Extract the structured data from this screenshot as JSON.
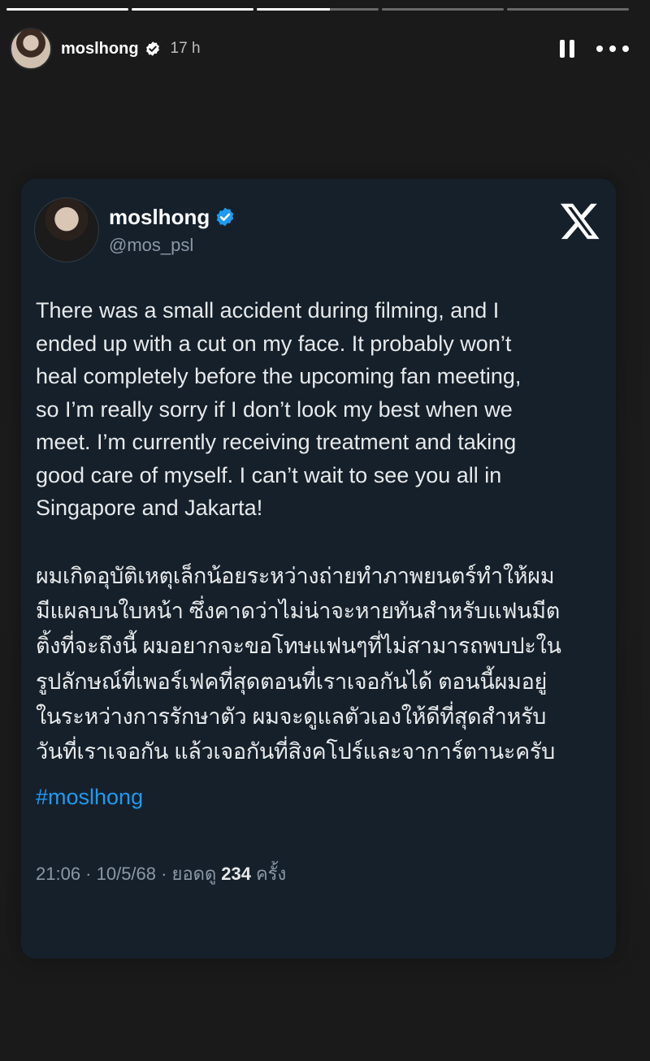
{
  "story": {
    "progress": [
      1,
      1,
      0.6,
      0,
      0
    ],
    "username": "moslhong",
    "time": "17 h"
  },
  "tweet": {
    "display_name": "moslhong",
    "handle": "@mos_psl",
    "text_en": "There was a small accident during filming, and I\nended up with a cut on my face. It probably won’t\nheal completely before the upcoming fan meeting,\nso I’m really sorry if I don’t look my best when we\nmeet. I’m currently receiving treatment and taking\ngood care of myself. I can’t wait to see you all in\nSingapore and Jakarta!",
    "text_th": "ผมเกิดอุบัติเหตุเล็กน้อยระหว่างถ่ายทำภาพยนตร์ทำให้ผม\nมีแผลบนใบหน้า ซึ่งคาดว่าไม่น่าจะหายทันสำหรับแฟนมีต\nติ้งที่จะถึงนี้ ผมอยากจะขอโทษแฟนๆที่ไม่สามารถพบปะใน\nรูปลักษณ์ที่เพอร์เฟคที่สุดตอนที่เราเจอกันได้ ตอนนี้ผมอยู่\nในระหว่างการรักษาตัว ผมจะดูแลตัวเองให้ดีที่สุดสำหรับ\nวันที่เราเจอกัน แล้วเจอกันที่สิงคโปร์และจาการ์ตานะครับ",
    "hashtag": "#moslhong",
    "meta_prefix": "21:06 · 10/5/68 · ยอดดู",
    "views": "234",
    "views_suffix": "ครั้ง"
  },
  "colors": {
    "card_bg": "#15202b",
    "verified": "#1d9bf0",
    "hashtag": "#1d9bf0"
  },
  "icons": [
    "verified-badge-icon",
    "pause-icon",
    "more-icon",
    "x-logo-icon"
  ]
}
